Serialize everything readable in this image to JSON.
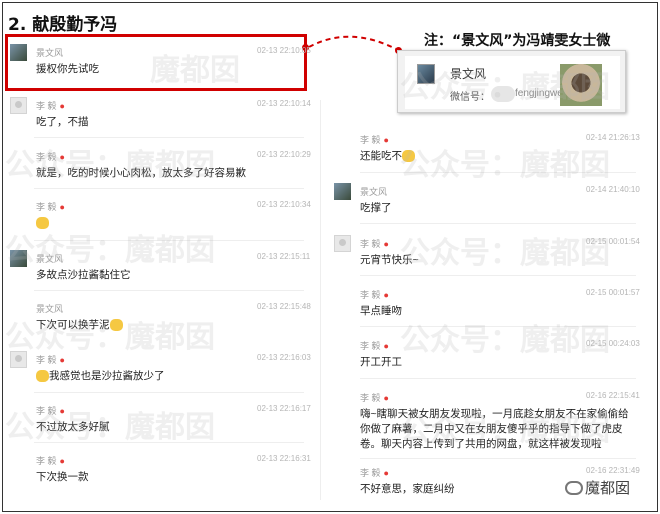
{
  "header": {
    "title": "2. 献殷勤予冯",
    "note": "注：“景文风”为冯靖雯女士微"
  },
  "card": {
    "name": "景文风",
    "wechat_label": "微信号：",
    "wechat_id": "fengjingwe"
  },
  "watermark": {
    "text": "公众号：魔都囡",
    "short": "魔都囡"
  },
  "logo": {
    "text": "魔都囡"
  },
  "left_messages": [
    {
      "name": "景文风",
      "time": "02-13 22:10:05",
      "text": "援权你先试吃",
      "avatar": "scene"
    },
    {
      "name": "李  毅",
      "time": "02-13 22:10:14",
      "text": "吃了，不描",
      "avatar": "plain"
    },
    {
      "name": "李  毅",
      "time": "02-13 22:10:29",
      "text": "就是，吃的时候小心肉松，放太多了好容易歉",
      "avatar": "plain"
    },
    {
      "name": "李  毅",
      "time": "02-13 22:10:34",
      "text": "",
      "avatar": "plain"
    },
    {
      "name": "景文风",
      "time": "02-13 22:15:11",
      "text": "多故点沙拉酱黏住它",
      "avatar": "scene"
    },
    {
      "name": "景文风",
      "time": "02-13 22:15:48",
      "text": "下次可以换芋泥",
      "avatar": "none"
    },
    {
      "name": "李  毅",
      "time": "02-13 22:16:03",
      "text": "我感觉也是沙拉酱放少了",
      "avatar": "plain"
    },
    {
      "name": "李  毅",
      "time": "02-13 22:16:17",
      "text": "不过放太多好腻",
      "avatar": "none"
    },
    {
      "name": "李  毅",
      "time": "02-13 22:16:31",
      "text": "下次换一款",
      "avatar": "none"
    }
  ],
  "right_messages": [
    {
      "name": "李  毅",
      "time": "02-14 21:26:13",
      "text": "还能吃不",
      "avatar": "none"
    },
    {
      "name": "景文风",
      "time": "02-14 21:40:10",
      "text": "吃撑了",
      "avatar": "scene"
    },
    {
      "name": "李  毅",
      "time": "02-15 00:01:54",
      "text": "元宵节快乐~",
      "avatar": "plain"
    },
    {
      "name": "李  毅",
      "time": "02-15 00:01:57",
      "text": "早点睡吻",
      "avatar": "none"
    },
    {
      "name": "李  毅",
      "time": "02-15 00:24:03",
      "text": "开工开工",
      "avatar": "none"
    },
    {
      "name": "李  毅",
      "time": "02-16 22:15:41",
      "text": "嗨~瞎聊天被女朋友发现啦，一月底趁女朋友不在家偷偷给你做了麻薯，二月中又在女朋友傻乎乎的指导下做了虎皮卷。聊天内容上传到了共用的网盘，就这样被发现啦",
      "avatar": "none"
    },
    {
      "name": "李  毅",
      "time": "02-16 22:31:49",
      "text": "不好意思，家庭纠纷",
      "avatar": "none"
    }
  ]
}
